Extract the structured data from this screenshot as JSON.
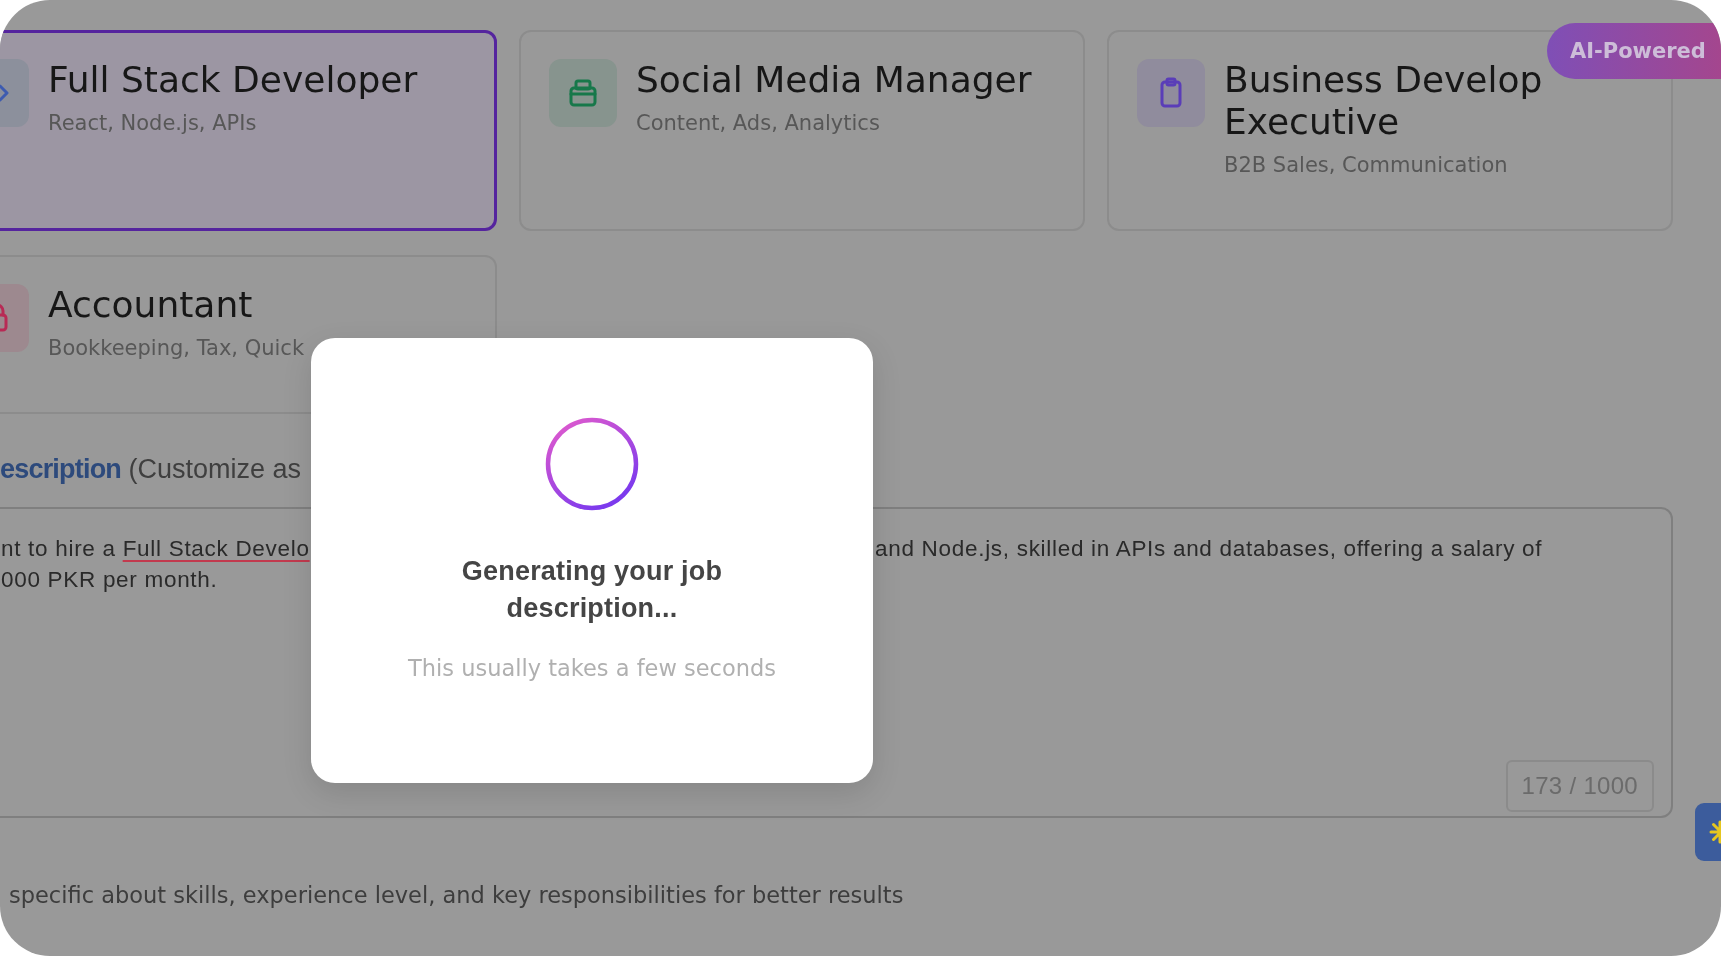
{
  "templates": [
    {
      "title": "Full Stack Developer",
      "skills": "React, Node.js, APIs",
      "color": "#3d5bb0",
      "selected": true
    },
    {
      "title": "Social Media Manager",
      "skills": "Content, Ads, Analytics",
      "color": "#17784a",
      "selected": false
    },
    {
      "title": "Business Develop Executive",
      "skills": "B2B Sales, Communication",
      "color": "#5a3db8",
      "selected": false
    },
    {
      "title": "Accountant",
      "skills": "Bookkeeping, Tax, Quick",
      "color": "#b82a55",
      "selected": false
    }
  ],
  "badge": "AI-Powered",
  "description": {
    "label": "**escription** (Customize as",
    "value_lines": [
      {
        "left": [
          {
            "text": "nt to hire a ",
            "spell_error": false
          },
          {
            "text": "Full Stack Develo",
            "spell_error": true
          }
        ],
        "right": "and Node.js, skilled in APIs and databases, offering a salary of"
      },
      {
        "left": [
          {
            "text": "000 PKR per month.",
            "spell_error": false
          }
        ]
      }
    ],
    "counter": "173 / 1000"
  },
  "hint": "specific about skills, experience level, and key responsibilities for better results",
  "dialog": {
    "title": "Generating your job description...",
    "subtitle": "This usually takes a few seconds"
  }
}
